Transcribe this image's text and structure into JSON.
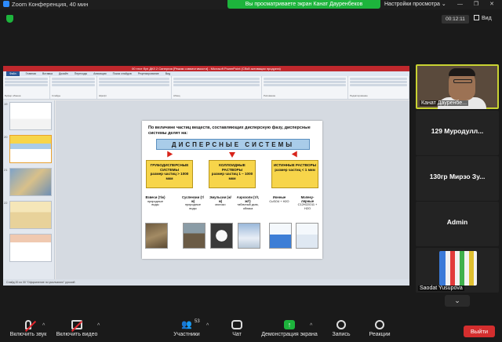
{
  "topbar": {
    "app_title": "Zoom Конференция, 40 мин",
    "share_banner": "Вы просматриваете экран Канат Дауренбеков",
    "view_settings": "Настройки просмотра ⌄",
    "window_controls": "— ❐ ✕"
  },
  "meeting": {
    "timer": "00:12:11",
    "view_label": "Вид"
  },
  "ppt": {
    "title": "00 тест бүгі ДКЗ 2 Синергия [Режим совместимости] - Microsoft PowerPoint (Сбой активации продукта)",
    "tabs": [
      "Файл",
      "Главная",
      "Вставка",
      "Дизайн",
      "Переходы",
      "Анимация",
      "Показ слайдов",
      "Рецензирование",
      "Вид"
    ],
    "ribbon_groups": [
      "Буфер обмена",
      "Слайды",
      "Шрифт",
      "Абзац",
      "Рисование",
      "Редактирование"
    ],
    "slide_numbers": [
      "19",
      "20",
      "21",
      "22"
    ],
    "status": "Слайд 20 из 30   \"Оформление по умолчанию\"   русский"
  },
  "slide": {
    "intro": "По величине частиц веществ, составляющих дисперсную фазу, дисперсные системы делят на:",
    "banner": "ДИСПЕРСНЫЕ СИСТЕМЫ",
    "categories": [
      {
        "name": "ГРУБОДИСПЕРСНЫЕ СИСТЕМЫ",
        "size": "размер частиц > 1000 мкм"
      },
      {
        "name": "КОЛЛОИДНЫЕ РАСТВОРЫ",
        "size": "размер частиц 1 – 1000 мкм"
      },
      {
        "name": "ИСТИННЫЕ РАСТВОРЫ",
        "size": "размер частиц < 1 мкм"
      }
    ],
    "items": [
      {
        "title": "Взвеси (т/ж)",
        "example": "природные воды"
      },
      {
        "title": "Суспензии (т/ж)",
        "example": "природные воды"
      },
      {
        "title": "Эмульсии (ж/ж)",
        "example": "молоко"
      },
      {
        "title": "Аэрозоли (т/г, ж/г)",
        "example": "табачный дым, облака"
      },
      {
        "title": "Ионные",
        "example": "CuSO4 + H2O"
      },
      {
        "title": "Молеку-лярные",
        "example": "C12H22O11 + H2O"
      }
    ]
  },
  "participants": [
    {
      "name": "Канат Дауренбе...",
      "type": "video"
    },
    {
      "name": "129    Муродулл...",
      "type": "name"
    },
    {
      "name": "130гр  Мирзо Зу...",
      "type": "name"
    },
    {
      "name": "Admin",
      "type": "name"
    },
    {
      "name": "Saodat Yusupova",
      "type": "video"
    }
  ],
  "toolbar": {
    "mute": "Включить звук",
    "video": "Включить видео",
    "participants": "Участники",
    "participants_count": "53",
    "chat": "Чат",
    "share": "Демонстрация экрана",
    "record": "Запись",
    "reactions": "Реакции",
    "leave": "Выйти"
  },
  "colors": {
    "share_green": "#1db43c",
    "leave_red": "#d42e2e",
    "active_speaker": "#c9d332"
  }
}
